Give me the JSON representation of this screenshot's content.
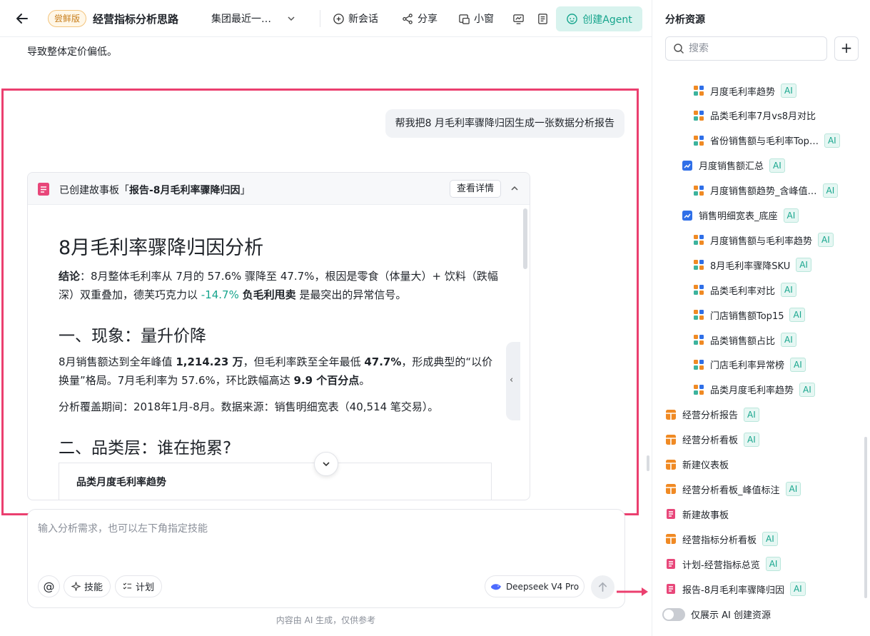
{
  "topbar": {
    "version_badge": "尝鲜版",
    "title": "经营指标分析思路",
    "dataset": "集团最近一…",
    "new_chat": "新会话",
    "share": "分享",
    "mini_window": "小窗",
    "create_agent": "创建Agent"
  },
  "chat": {
    "prev_text": "导致整体定价偏低。",
    "user_message": "帮我把8 月毛利率骤降归因生成一张数据分析报告",
    "story": {
      "prefix": "已创建故事板「",
      "name": "报告-8月毛利率骤降归因",
      "suffix": "」",
      "detail_button": "查看详情",
      "report_title": "8月毛利率骤降归因分析",
      "conclusion_label": "结论",
      "conclusion_a": "：8月整体毛利率从 7月的 57.6% 骤降至 47.7%，根因是零食（体量大）+ 饮料（跌幅深）双重叠加，德芙巧克力以 ",
      "conclusion_neg": "-14.7%",
      "conclusion_b": " ",
      "conclusion_bold": "负毛利甩卖",
      "conclusion_c": " 是最突出的异常信号。",
      "h2_1": "一、现象：量升价降",
      "p1_a": "8月销售额达到全年峰值 ",
      "p1_b": "1,214.23 万",
      "p1_c": "，但毛利率跌至全年最低 ",
      "p1_d": "47.7%",
      "p1_e": "，形成典型的“以价换量”格局。7月毛利率为 57.6%，环比跌幅高达 ",
      "p1_f": "9.9 个百分点",
      "p1_g": "。",
      "p2": "分析覆盖期间：2018年1月-8月。数据来源：销售明细宽表（40,514 笔交易）。",
      "h2_2": "二、品类层：谁在拖累?",
      "sub_card_title": "品类月度毛利率趋势"
    }
  },
  "composer": {
    "placeholder": "输入分析需求，也可以左下角指定技能",
    "at": "@",
    "skills": "技能",
    "plan": "计划",
    "model": "Deepseek V4 Pro"
  },
  "disclaimer": "内容由 AI 生成，仅供参考",
  "panel": {
    "title": "分析资源",
    "search_placeholder": "搜索",
    "ai_tag": "AI",
    "items": [
      {
        "label": "月度毛利率趋势",
        "icon": "chart-widget-icon",
        "ai": true
      },
      {
        "label": "品类毛利率7月vs8月对比",
        "icon": "chart-widget-icon",
        "ai": false
      },
      {
        "label": "省份销售额与毛利率Top…",
        "icon": "chart-widget-icon",
        "ai": true
      },
      {
        "label": "月度销售额汇总",
        "icon": "dataset-icon",
        "ai": true
      },
      {
        "label": "月度销售额趋势_含峰值…",
        "icon": "chart-widget-icon",
        "ai": true
      },
      {
        "label": "销售明细宽表_底座",
        "icon": "dataset-icon",
        "ai": true
      },
      {
        "label": "月度销售额与毛利率趋势",
        "icon": "chart-widget-icon",
        "ai": true
      },
      {
        "label": "8月毛利率骤降SKU",
        "icon": "chart-widget-icon",
        "ai": true
      },
      {
        "label": "品类毛利率对比",
        "icon": "chart-widget-icon",
        "ai": true
      },
      {
        "label": "门店销售额Top15",
        "icon": "chart-widget-icon",
        "ai": true
      },
      {
        "label": "品类销售额占比",
        "icon": "chart-widget-icon",
        "ai": true
      },
      {
        "label": "门店毛利率异常榜",
        "icon": "chart-widget-icon",
        "ai": true
      },
      {
        "label": "品类月度毛利率趋势",
        "icon": "chart-widget-icon",
        "ai": true
      },
      {
        "label": "经营分析报告",
        "icon": "dashboard-icon",
        "ai": true
      },
      {
        "label": "经营分析看板",
        "icon": "dashboard-icon",
        "ai": true
      },
      {
        "label": "新建仪表板",
        "icon": "dashboard-icon",
        "ai": false
      },
      {
        "label": "经营分析看板_峰值标注",
        "icon": "dashboard-icon",
        "ai": true
      },
      {
        "label": "新建故事板",
        "icon": "storyboard-icon",
        "ai": false
      },
      {
        "label": "经营指标分析看板",
        "icon": "dashboard-icon",
        "ai": true
      },
      {
        "label": "计划-经营指标总览",
        "icon": "storyboard-icon",
        "ai": true
      },
      {
        "label": "报告-8月毛利率骤降归因",
        "icon": "storyboard-icon",
        "ai": true
      }
    ],
    "toggle_label": "仅展示 AI 创建资源"
  },
  "colors": {
    "accent": "#17a58d",
    "highlight": "#eb3f6f",
    "widget_orange": "#f08a24",
    "dataset_blue": "#2f6fe8",
    "storyboard_red": "#e8477a"
  }
}
